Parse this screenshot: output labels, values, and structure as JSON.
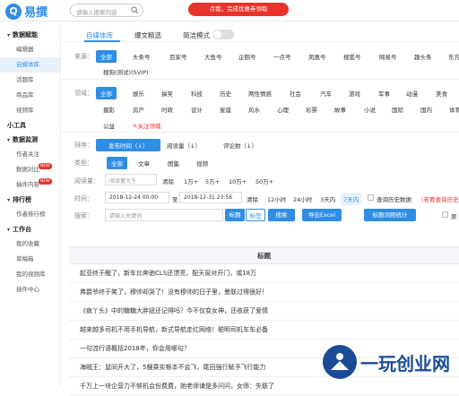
{
  "header": {
    "logo_mark": "Q",
    "logo_text": "易撰",
    "search_placeholder": "请输入搜索内容",
    "promo": "点我，完成优惠券领取"
  },
  "sidebar": [
    {
      "section": "数据赋能",
      "items": [
        {
          "label": "编辑器"
        },
        {
          "label": "自媒体库",
          "active": true
        },
        {
          "label": "活题库"
        },
        {
          "label": "商品库"
        },
        {
          "label": "视频库"
        }
      ]
    },
    {
      "section": "小工具",
      "items": []
    },
    {
      "section": "数据监测",
      "items": [
        {
          "label": "作者关注"
        },
        {
          "label": "数据对比",
          "new": "NEW"
        },
        {
          "label": "稿件内容",
          "new": "NEW"
        }
      ]
    },
    {
      "section": "排行榜",
      "items": [
        {
          "label": "作者排行榜"
        }
      ]
    },
    {
      "section": "工作台",
      "items": [
        {
          "label": "我的收藏"
        },
        {
          "label": "草稿箱"
        },
        {
          "label": "我的视频库"
        },
        {
          "label": "插件中心"
        }
      ]
    }
  ],
  "tabs": {
    "tab1": "自媒体库",
    "tab2": "爆文精选",
    "simple_mode": "简洁模式"
  },
  "filters": {
    "source_label": "来源：",
    "sources": [
      "全部",
      "头条号",
      "百家号",
      "大鱼号",
      "企鹅号",
      "一点号",
      "凤凰号",
      "搜狐号",
      "网易号",
      "趣头条",
      "东方号",
      "搜狗(测试)(SVIP)"
    ],
    "domain_label": "领域：",
    "domains_row1": [
      "全部",
      "娱乐",
      "搞笑",
      "科技",
      "历史",
      "两性情感",
      "社会",
      "汽车",
      "游戏",
      "军事",
      "动漫",
      "美食"
    ],
    "domains_row2": [
      "摄影",
      "房产",
      "时政",
      "设计",
      "星座",
      "风水",
      "心理",
      "彩票",
      "故事",
      "小说",
      "国际",
      "国内",
      "体育"
    ],
    "domains_row3": [
      "公益",
      "关注领域"
    ],
    "sort_label": "排序：",
    "sort_options": [
      "发布时间（↓）",
      "阅读量（↓）",
      "评论数（↓）"
    ],
    "type_label": "类型：",
    "type_options": [
      "全部",
      "文章",
      "图集",
      "视频"
    ],
    "read_label": "阅读量：",
    "read_placeholder": "阅读量大于",
    "read_options": [
      "清除",
      "1万+",
      "5万+",
      "10万+",
      "50万+"
    ],
    "time_label": "时间：",
    "date_start": "2018-12-24 00:00",
    "date_to": "至",
    "date_end": "2018-12-31 23:56",
    "time_options": [
      "清除",
      "12小时",
      "24小时",
      "3天内",
      "7天内"
    ],
    "history_label": "查询历史数据",
    "history_note": "（若要查询历史数据",
    "search_label": "搜索：",
    "keyword_placeholder": "请输入关键词",
    "toggle_title": "标题",
    "toggle_tag": "标签",
    "btn_search": "搜索",
    "btn_export": "导出Excel",
    "btn_stats": "标题词频统计",
    "cb_orig": "原"
  },
  "table": {
    "header": "标题",
    "rows": [
      "起亚终于醒了，新车比奔驰CLS还漂亮，配天窗对开门，或18万",
      "弗爵爷终于笑了，穆帅却哭了！没有穆帅的日子里，曼联过得很好！",
      "《疯丫头》中的糖糖大胖妞还记得吗？今不仅变女神，还收获了爱情",
      "越来越多司机不用手机导航，新式导航走红网络！聪明司机车车必备",
      "一句流行语概括2018年，你会用哪句？",
      "海贼王：鼠同开大了，5艘乘实根本不会飞，尾田强行赋予飞行能力",
      "千万上一块企营力不够机会份费费，她老师谏是多问问，女师：失联了"
    ]
  },
  "watermark": "一玩创业网"
}
